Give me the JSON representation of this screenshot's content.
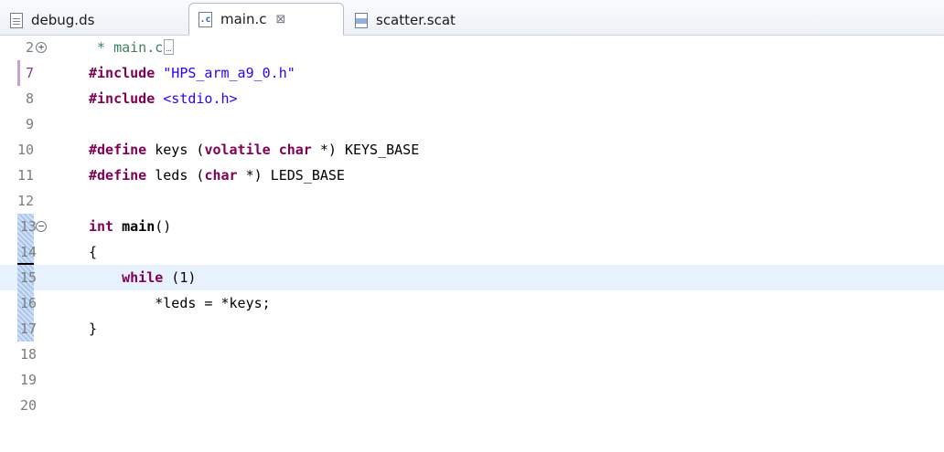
{
  "tabs": [
    {
      "label": "debug.ds",
      "icon": "document-icon",
      "active": false
    },
    {
      "label": "main.c",
      "icon": "c-source-file-icon",
      "active": true,
      "close_glyph": "⊠"
    },
    {
      "label": "scatter.scat",
      "icon": "scatter-file-icon",
      "active": false
    }
  ],
  "editor": {
    "lines": [
      {
        "number": "2",
        "fold": "expand",
        "segments": [
          {
            "type": "comment",
            "text": " * main.c"
          }
        ],
        "folded_marker": true
      },
      {
        "number": "7",
        "segments": [
          {
            "type": "keyword",
            "text": "#include"
          },
          {
            "type": "plain",
            "text": " "
          },
          {
            "type": "string",
            "text": "\"HPS_arm_a9_0.h\""
          }
        ]
      },
      {
        "number": "8",
        "segments": [
          {
            "type": "keyword",
            "text": "#include"
          },
          {
            "type": "plain",
            "text": " "
          },
          {
            "type": "string",
            "text": "<stdio.h>"
          }
        ]
      },
      {
        "number": "9",
        "segments": []
      },
      {
        "number": "10",
        "segments": [
          {
            "type": "keyword",
            "text": "#define"
          },
          {
            "type": "plain",
            "text": " keys ("
          },
          {
            "type": "keyword",
            "text": "volatile"
          },
          {
            "type": "plain",
            "text": " "
          },
          {
            "type": "keyword",
            "text": "char"
          },
          {
            "type": "plain",
            "text": " *) KEYS_BASE"
          }
        ]
      },
      {
        "number": "11",
        "segments": [
          {
            "type": "keyword",
            "text": "#define"
          },
          {
            "type": "plain",
            "text": " leds ("
          },
          {
            "type": "keyword",
            "text": "char"
          },
          {
            "type": "plain",
            "text": " *) LEDS_BASE"
          }
        ]
      },
      {
        "number": "12",
        "segments": []
      },
      {
        "number": "13",
        "fold": "collapse",
        "segments": [
          {
            "type": "keyword",
            "text": "int"
          },
          {
            "type": "plain",
            "text": " "
          },
          {
            "type": "function",
            "text": "main"
          },
          {
            "type": "plain",
            "text": "()"
          }
        ]
      },
      {
        "number": "14",
        "segments": [
          {
            "type": "plain",
            "text": "{"
          }
        ]
      },
      {
        "number": "15",
        "current": true,
        "segments": [
          {
            "type": "plain",
            "text": "    "
          },
          {
            "type": "keyword",
            "text": "while"
          },
          {
            "type": "plain",
            "text": " (1)"
          }
        ]
      },
      {
        "number": "16",
        "segments": [
          {
            "type": "plain",
            "text": "        *leds = *keys;"
          }
        ]
      },
      {
        "number": "17",
        "segments": [
          {
            "type": "plain",
            "text": "}"
          }
        ]
      },
      {
        "number": "18",
        "segments": []
      },
      {
        "number": "19",
        "segments": []
      },
      {
        "number": "20",
        "segments": []
      }
    ]
  }
}
